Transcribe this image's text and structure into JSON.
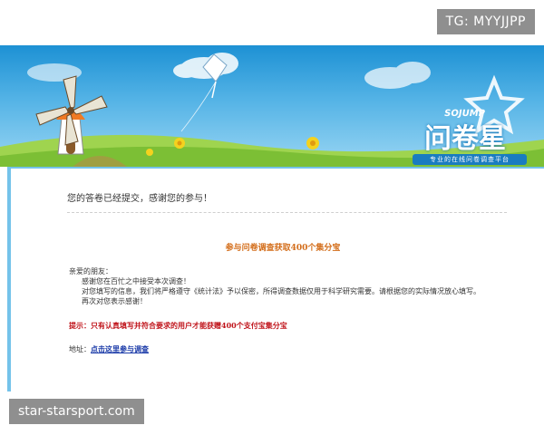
{
  "overlay": {
    "tg_label": "TG: MYYJJPP",
    "site_label": "star-starsport.com"
  },
  "banner": {
    "brand_small": "SOJUMP",
    "brand_name": "问卷星",
    "brand_tagline": "专业的在线问卷调查平台",
    "colors": {
      "sky_top": "#1d91d4",
      "sky_bottom": "#9ad6f3",
      "grass": "#8cc63f"
    },
    "icons": [
      "windmill-icon",
      "kite-icon",
      "flower-icon",
      "cloud-icon",
      "star-icon"
    ]
  },
  "content": {
    "thanks_message": "您的答卷已经提交，感谢您的参与！",
    "promo_title": "参与问卷调查获取400个集分宝",
    "greeting": "亲爱的朋友：",
    "lines": [
      "感谢您在百忙之中接受本次调查！",
      "对您填写的信息，我们将严格遵守《统计法》予以保密，所得调查数据仅用于科学研究需要。请根据您的实际情况放心填写。",
      "再次对您表示感谢！"
    ],
    "hint": "提示：只有认真填写并符合要求的用户才能获赠400个支付宝集分宝",
    "address_label": "地址：",
    "address_link": "点击这里参与调查",
    "colors": {
      "title": "#d36d1a",
      "hint": "#c0141b",
      "link": "#1a3aa8"
    }
  }
}
